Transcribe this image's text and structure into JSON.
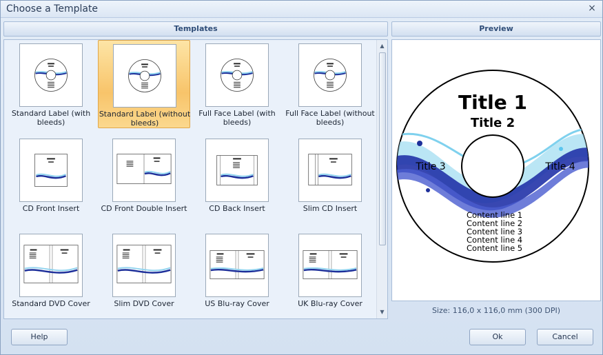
{
  "window": {
    "title": "Choose a Template",
    "close_glyph": "×"
  },
  "headers": {
    "templates": "Templates",
    "preview": "Preview"
  },
  "templates": [
    {
      "label": "Standard Label (with bleeds)",
      "kind": "disc",
      "selected": false
    },
    {
      "label": "Standard Label (without bleeds)",
      "kind": "disc",
      "selected": true
    },
    {
      "label": "Full Face Label (with bleeds)",
      "kind": "disc",
      "selected": false
    },
    {
      "label": "Full Face Label (without bleeds)",
      "kind": "disc",
      "selected": false
    },
    {
      "label": "CD Front Insert",
      "kind": "front",
      "selected": false
    },
    {
      "label": "CD Front Double Insert",
      "kind": "double",
      "selected": false
    },
    {
      "label": "CD Back Insert",
      "kind": "back",
      "selected": false
    },
    {
      "label": "Slim CD Insert",
      "kind": "slim",
      "selected": false
    },
    {
      "label": "Standard DVD Cover",
      "kind": "dvd",
      "selected": false
    },
    {
      "label": "Slim DVD Cover",
      "kind": "dvd",
      "selected": false
    },
    {
      "label": "US Blu-ray Cover",
      "kind": "bluray",
      "selected": false
    },
    {
      "label": "UK Blu-ray Cover",
      "kind": "bluray",
      "selected": false
    }
  ],
  "preview": {
    "title1": "Title 1",
    "title2": "Title 2",
    "title3": "Title 3",
    "title4": "Title 4",
    "content_lines": [
      "Content line 1",
      "Content line 2",
      "Content line 3",
      "Content line 4",
      "Content line 5"
    ],
    "size_text": "Size: 116,0 x 116,0 mm (300 DPI)"
  },
  "buttons": {
    "help": "Help",
    "ok": "Ok",
    "cancel": "Cancel"
  },
  "colors": {
    "accent_selected": "#f8c46a",
    "swoosh_dark": "#1d2f9a",
    "swoosh_light": "#8fd3ef"
  },
  "icons": {
    "close": "close-icon",
    "scroll_up": "scroll-up-icon",
    "scroll_down": "scroll-down-icon"
  }
}
